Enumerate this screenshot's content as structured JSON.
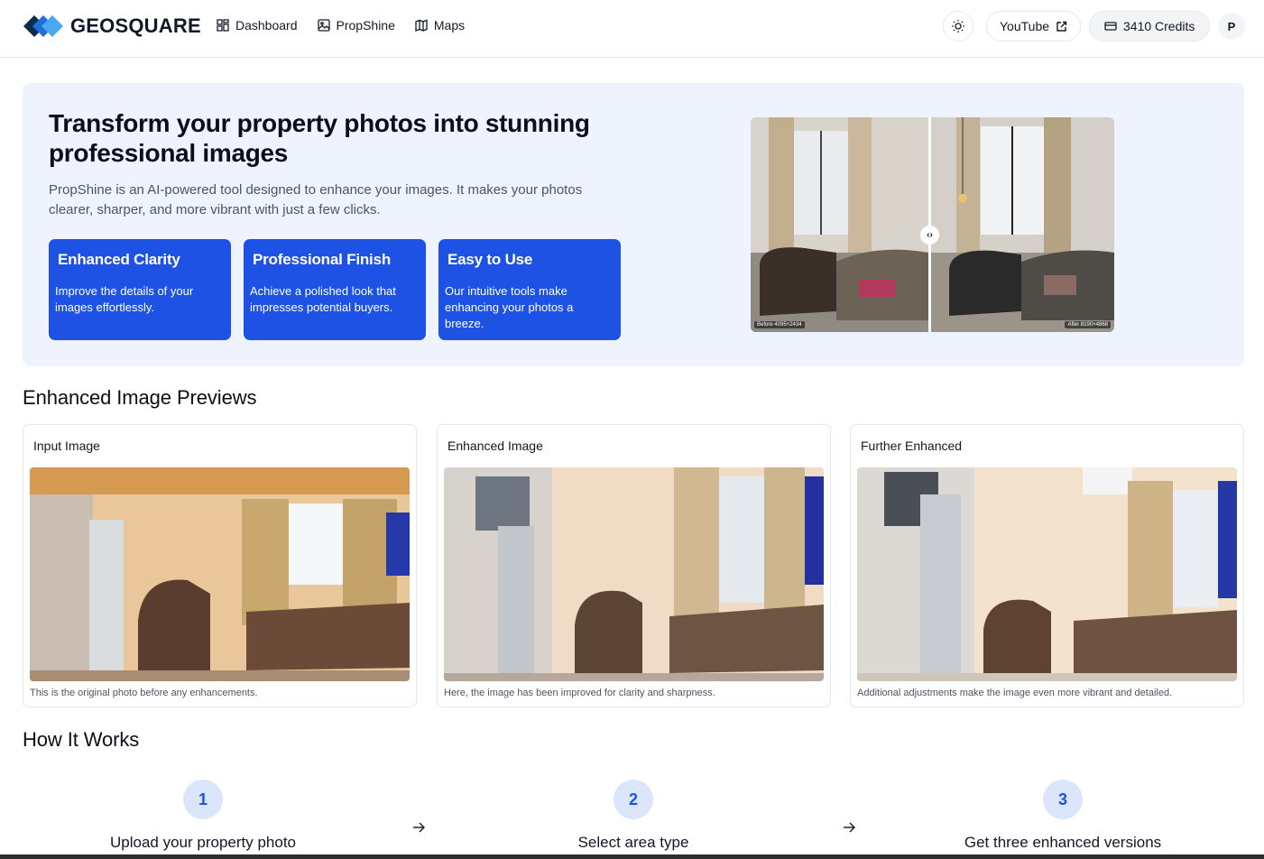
{
  "header": {
    "logo_text": "GEOSQUARE",
    "nav": [
      {
        "label": "Dashboard",
        "icon": "grid-icon"
      },
      {
        "label": "PropShine",
        "icon": "image-icon"
      },
      {
        "label": "Maps",
        "icon": "map-icon"
      }
    ],
    "youtube_label": "YouTube",
    "credits_label": "3410 Credits",
    "avatar_initial": "P"
  },
  "hero": {
    "title": "Transform your property photos into stunning professional images",
    "description": "PropShine is an AI-powered tool designed to enhance your images. It makes your photos clearer, sharper, and more vibrant with just a few clicks.",
    "features": [
      {
        "title": "Enhanced Clarity",
        "description": "Improve the details of your images effortlessly."
      },
      {
        "title": "Professional Finish",
        "description": "Achieve a polished look that impresses potential buyers."
      },
      {
        "title": "Easy to Use",
        "description": "Our intuitive tools make enhancing your photos a breeze."
      }
    ],
    "compare": {
      "before_tag": "Before 4095×2434",
      "after_tag": "After 8190×4868",
      "handle": "‹›"
    }
  },
  "previews": {
    "title": "Enhanced Image Previews",
    "items": [
      {
        "label": "Input Image",
        "caption": "This is the original photo before any enhancements."
      },
      {
        "label": "Enhanced Image",
        "caption": "Here, the image has been improved for clarity and sharpness."
      },
      {
        "label": "Further Enhanced",
        "caption": "Additional adjustments make the image even more vibrant and detailed."
      }
    ]
  },
  "how": {
    "title": "How It Works",
    "steps": [
      {
        "number": "1",
        "label": "Upload your property photo"
      },
      {
        "number": "2",
        "label": "Select area type"
      },
      {
        "number": "3",
        "label": "Get three enhanced versions"
      }
    ]
  },
  "colors": {
    "accent": "#1d52e4",
    "hero_bg": "#eef3fd",
    "step_circle_bg": "#dbe6fc"
  }
}
